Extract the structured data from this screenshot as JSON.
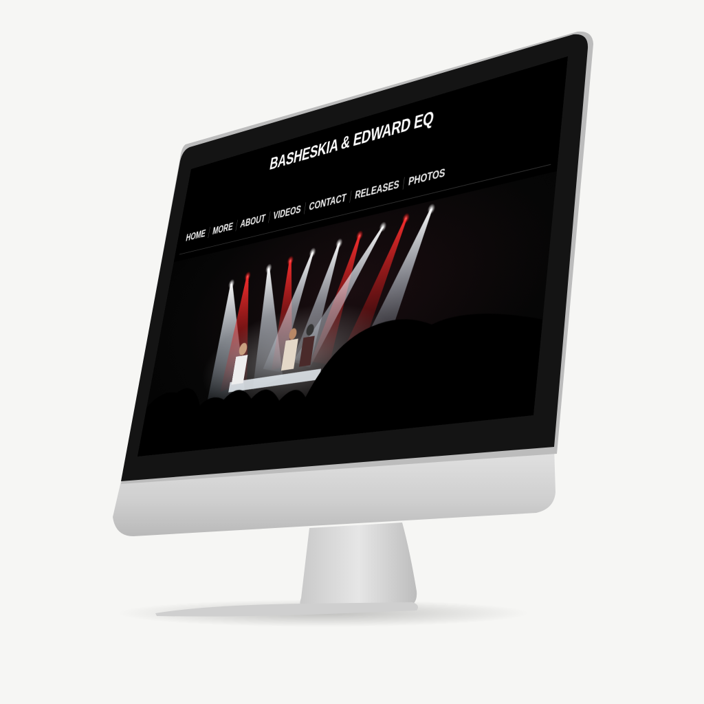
{
  "website": {
    "title": "BASHESKIA & EDWARD EQ",
    "nav": [
      {
        "label": "HOME"
      },
      {
        "label": "MORE"
      },
      {
        "label": "ABOUT"
      },
      {
        "label": "VIDEOS"
      },
      {
        "label": "CONTACT"
      },
      {
        "label": "RELEASES"
      },
      {
        "label": "PHOTOS"
      }
    ],
    "hero": {
      "subject": "concert-stage-photo",
      "colors": {
        "red_light": "#ff2a2a",
        "white_light": "#e8f4ff",
        "background": "#050505"
      }
    }
  },
  "device": {
    "type": "desktop-monitor",
    "colors": {
      "bezel": "#1b1b1b",
      "chin": "#d8d8d8",
      "stand": "#d2d2d2"
    }
  }
}
